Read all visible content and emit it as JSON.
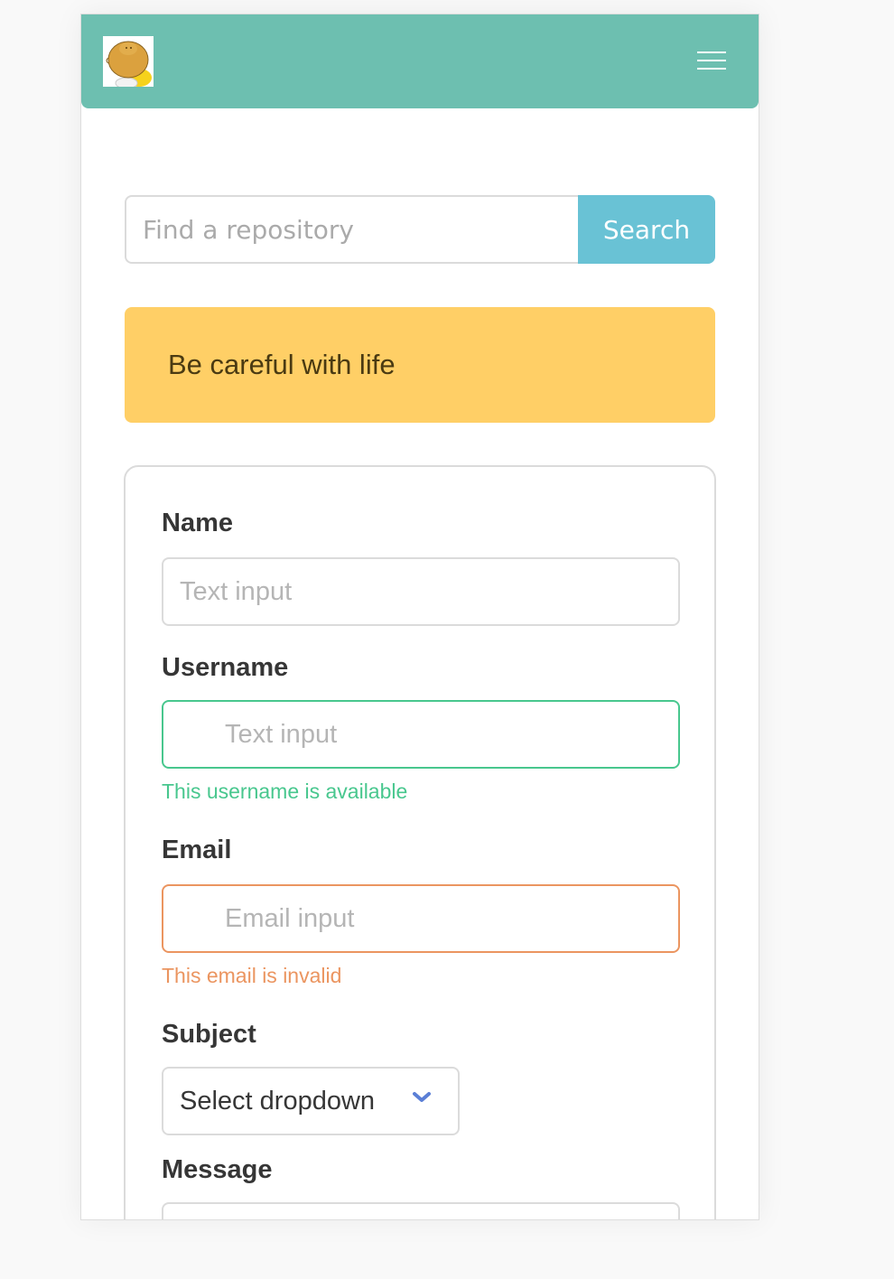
{
  "colors": {
    "navbar": "#6dbfb0",
    "search_button": "#69c2d5",
    "notification": "#ffcf66",
    "success": "#48c78e",
    "danger": "#eb9560",
    "chevron": "#5b7fd6"
  },
  "navbar": {
    "logo_icon": "character-avatar-icon",
    "menu_icon": "hamburger-menu-icon"
  },
  "search": {
    "placeholder": "Find a repository",
    "button_label": "Search"
  },
  "notification": {
    "text": "Be careful with life"
  },
  "form": {
    "name": {
      "label": "Name",
      "placeholder": "Text input"
    },
    "username": {
      "label": "Username",
      "placeholder": "Text input",
      "help": "This username is available",
      "state": "success"
    },
    "email": {
      "label": "Email",
      "placeholder": "Email input",
      "help": "This email is invalid",
      "state": "danger"
    },
    "subject": {
      "label": "Subject",
      "selected": "Select dropdown",
      "icon": "chevron-down-icon"
    },
    "message": {
      "label": "Message"
    }
  }
}
